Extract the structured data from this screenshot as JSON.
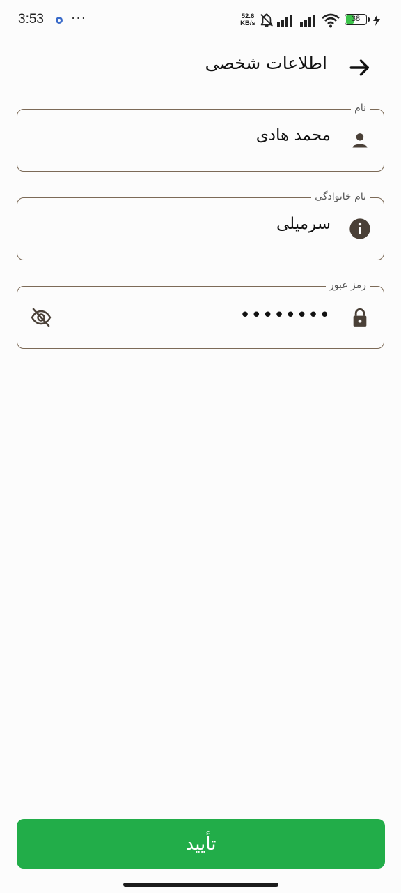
{
  "status_bar": {
    "time": "3:53",
    "dots": "···",
    "net_speed_value": "52.6",
    "net_speed_unit": "KB/s",
    "battery_level": "38",
    "battery_fraction": 0.38,
    "battery_color": "#3cc24a"
  },
  "header": {
    "title": "اطلاعات شخصی",
    "back_icon": "arrow-right-icon"
  },
  "form": {
    "first_name": {
      "label": "نام",
      "value": "محمد هادی",
      "icon": "person-icon"
    },
    "last_name": {
      "label": "نام خانوادگی",
      "value": "سرمیلی",
      "icon": "info-icon"
    },
    "password": {
      "label": "رمز عبور",
      "masked_value": "••••••••",
      "icon": "lock-icon",
      "toggle_icon": "eye-off-icon"
    }
  },
  "confirm_button": {
    "label": "تأیید",
    "color": "#22ad49"
  },
  "colors": {
    "field_border": "#7c6a57",
    "icon_color": "#4a4037"
  }
}
